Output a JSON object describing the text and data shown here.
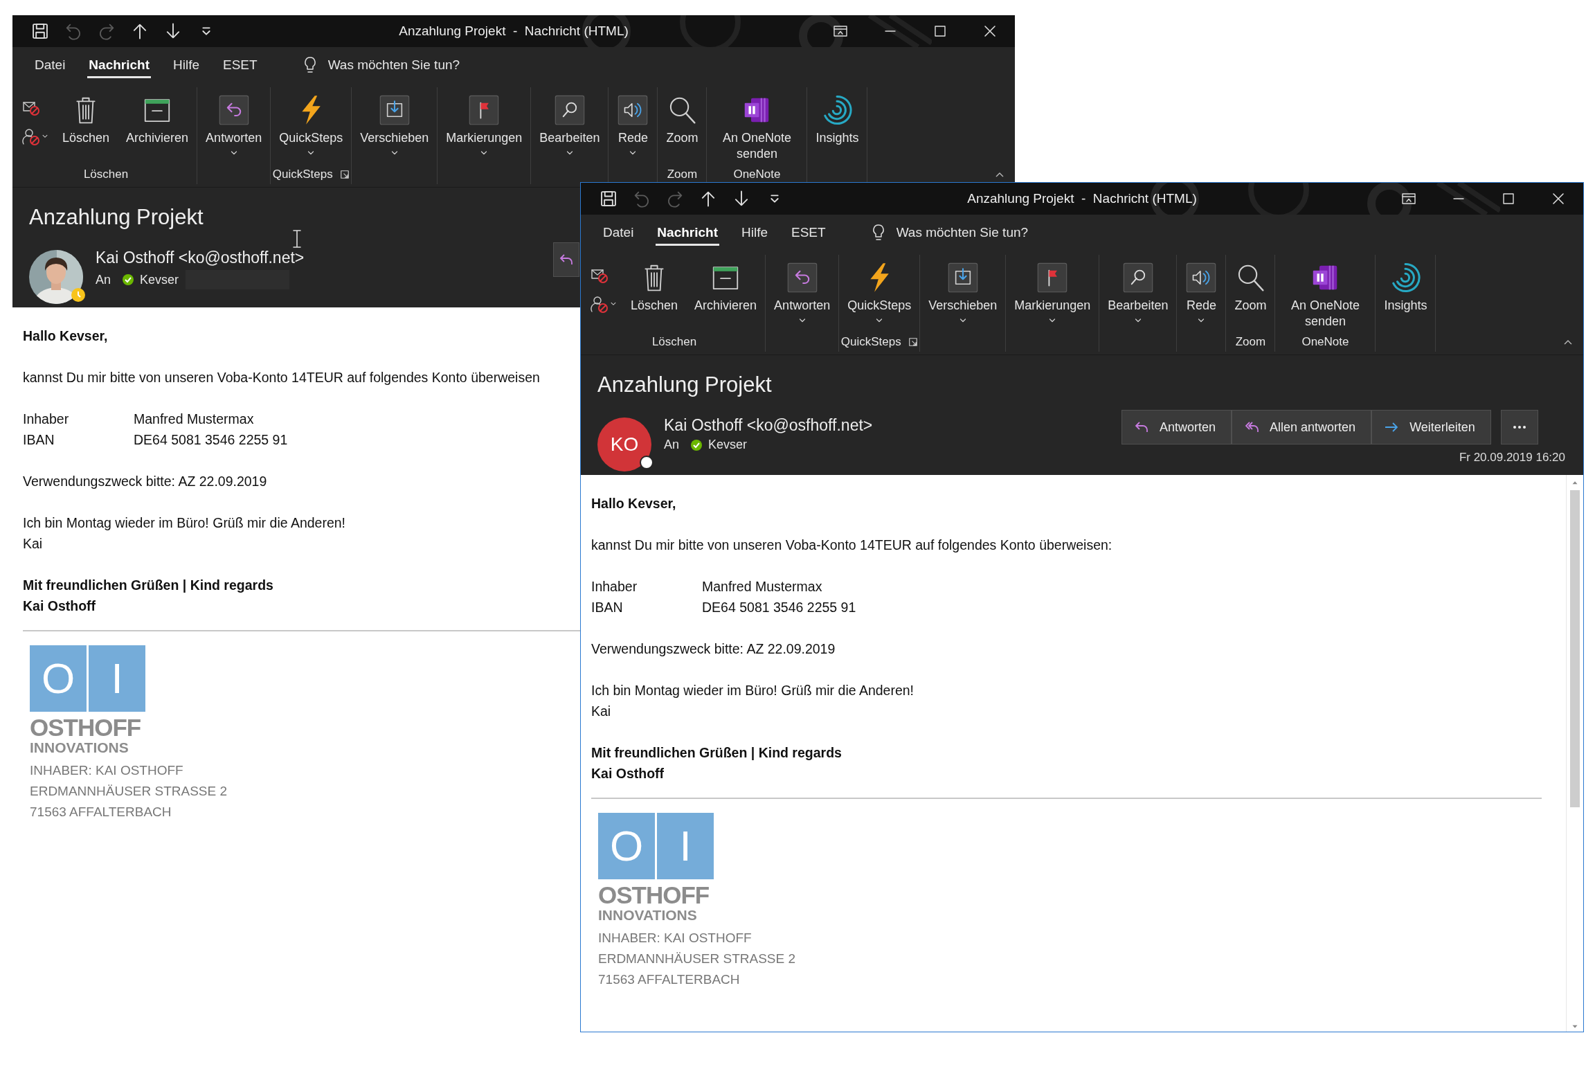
{
  "windows": [
    {
      "title": "Anzahlung Projekt  -  Nachricht (HTML)",
      "quick_access": [
        {
          "kind": "save",
          "disabled": false
        },
        {
          "kind": "undo",
          "disabled": true
        },
        {
          "kind": "redo",
          "disabled": true
        },
        {
          "kind": "up",
          "disabled": false
        },
        {
          "kind": "down",
          "disabled": false
        },
        {
          "kind": "customize",
          "disabled": false
        }
      ],
      "menu": [
        {
          "label": "Datei",
          "selected": false
        },
        {
          "label": "Nachricht",
          "selected": true
        },
        {
          "label": "Hilfe",
          "selected": false
        },
        {
          "label": "ESET",
          "selected": false
        }
      ],
      "tell_me": {
        "placeholder": "Was möchten Sie tun?"
      },
      "ribbon": [
        {
          "label": "Löschen",
          "launcher": false,
          "items": [
            {
              "kind": "small_pair"
            },
            {
              "kind": "delete",
              "label": "Löschen",
              "caret": false
            },
            {
              "kind": "archive",
              "label": "Archivieren",
              "caret": false
            }
          ]
        },
        {
          "items": [
            {
              "kind": "reply",
              "label": "Antworten",
              "caret": true
            }
          ],
          "launcher": false
        },
        {
          "label": "QuickSteps",
          "launcher": true,
          "items": [
            {
              "kind": "quicksteps",
              "label": "QuickSteps",
              "caret": true
            }
          ]
        },
        {
          "items": [
            {
              "kind": "move",
              "label": "Verschieben",
              "caret": true
            }
          ],
          "launcher": false
        },
        {
          "items": [
            {
              "kind": "flag",
              "label": "Markierungen",
              "caret": true
            }
          ],
          "launcher": false
        },
        {
          "items": [
            {
              "kind": "edit",
              "label": "Bearbeiten",
              "caret": true
            }
          ],
          "launcher": false
        },
        {
          "items": [
            {
              "kind": "speech",
              "label": "Rede",
              "caret": true
            }
          ],
          "launcher": false
        },
        {
          "label": "Zoom",
          "launcher": false,
          "items": [
            {
              "kind": "zoom",
              "label": "Zoom",
              "caret": false
            }
          ]
        },
        {
          "label": "OneNote",
          "launcher": false,
          "items": [
            {
              "kind": "onenote",
              "label": "An OneNote senden",
              "caret": false
            }
          ]
        },
        {
          "items": [
            {
              "kind": "insights",
              "label": "Insights",
              "caret": false
            }
          ],
          "launcher": false
        }
      ],
      "header": {
        "subject": "Anzahlung Projekt",
        "away": true,
        "sender": "Kai Osthoff <ko@osthoff.net>",
        "to_label": "An",
        "recipient": "Kevser",
        "redacted": true,
        "actions": [
          {
            "kind": "reply"
          }
        ]
      },
      "body": [
        {
          "kind": "paragraph",
          "bold": true,
          "lines": [
            "Hallo Kevser,"
          ]
        },
        {
          "kind": "paragraph",
          "bold": false,
          "lines": [
            "kannst Du mir bitte von unseren Voba-Konto 14TEUR auf folgendes Konto überweisen"
          ]
        },
        {
          "kind": "fields",
          "rows": [
            {
              "label": "Inhaber",
              "value": "Manfred Mustermax"
            },
            {
              "label": "IBAN",
              "value": "DE64 5081 3546 2255 91"
            }
          ]
        },
        {
          "kind": "paragraph",
          "bold": false,
          "lines": [
            "Verwendungszweck bitte: AZ 22.09.2019"
          ]
        },
        {
          "kind": "paragraph",
          "bold": false,
          "lines": [
            "Ich bin Montag wieder im Büro! Grüß mir die Anderen!",
            "Kai"
          ]
        },
        {
          "kind": "signature",
          "lines": [
            "Mit freundlichen Grüßen | Kind regards",
            "Kai Osthoff"
          ]
        },
        {
          "kind": "rule"
        },
        {
          "kind": "logo",
          "tiles": [
            "O",
            "I"
          ],
          "name": "OSTHOFF",
          "tagline": "INNOVATIONS"
        },
        {
          "kind": "address",
          "lines": [
            "INHABER: KAI OSTHOFF",
            "ERDMANNHÄUSER STRASSE 2",
            "71563 AFFALTERBACH"
          ]
        }
      ]
    },
    {
      "title": "Anzahlung Projekt  -  Nachricht (HTML)",
      "quick_access": [
        {
          "kind": "save",
          "disabled": false
        },
        {
          "kind": "undo",
          "disabled": true
        },
        {
          "kind": "redo",
          "disabled": true
        },
        {
          "kind": "up",
          "disabled": false
        },
        {
          "kind": "down",
          "disabled": false
        },
        {
          "kind": "customize",
          "disabled": false
        }
      ],
      "menu": [
        {
          "label": "Datei",
          "selected": false
        },
        {
          "label": "Nachricht",
          "selected": true
        },
        {
          "label": "Hilfe",
          "selected": false
        },
        {
          "label": "ESET",
          "selected": false
        }
      ],
      "tell_me": {
        "placeholder": "Was möchten Sie tun?"
      },
      "ribbon": [
        {
          "label": "Löschen",
          "launcher": false,
          "items": [
            {
              "kind": "small_pair"
            },
            {
              "kind": "delete",
              "label": "Löschen",
              "caret": false
            },
            {
              "kind": "archive",
              "label": "Archivieren",
              "caret": false
            }
          ]
        },
        {
          "items": [
            {
              "kind": "reply",
              "label": "Antworten",
              "caret": true
            }
          ],
          "launcher": false
        },
        {
          "label": "QuickSteps",
          "launcher": true,
          "items": [
            {
              "kind": "quicksteps",
              "label": "QuickSteps",
              "caret": true
            }
          ]
        },
        {
          "items": [
            {
              "kind": "move",
              "label": "Verschieben",
              "caret": true
            }
          ],
          "launcher": false
        },
        {
          "items": [
            {
              "kind": "flag",
              "label": "Markierungen",
              "caret": true
            }
          ],
          "launcher": false
        },
        {
          "items": [
            {
              "kind": "edit",
              "label": "Bearbeiten",
              "caret": true
            }
          ],
          "launcher": false
        },
        {
          "items": [
            {
              "kind": "speech",
              "label": "Rede",
              "caret": true
            }
          ],
          "launcher": false
        },
        {
          "label": "Zoom",
          "launcher": false,
          "items": [
            {
              "kind": "zoom",
              "label": "Zoom",
              "caret": false
            }
          ]
        },
        {
          "label": "OneNote",
          "launcher": false,
          "items": [
            {
              "kind": "onenote",
              "label": "An OneNote senden",
              "caret": false
            }
          ]
        },
        {
          "items": [
            {
              "kind": "insights",
              "label": "Insights",
              "caret": false
            }
          ],
          "launcher": false
        }
      ],
      "header": {
        "subject": "Anzahlung Projekt",
        "avatar": {
          "kind": "initials",
          "initials": "KO"
        },
        "away": false,
        "sender": "Kai Osthoff <ko@osfhoff.net>",
        "to_label": "An",
        "recipient": "Kevser",
        "redacted": false,
        "actions": [
          {
            "kind": "reply",
            "label": "Antworten"
          },
          {
            "kind": "reply_all",
            "label": "Allen antworten"
          },
          {
            "kind": "forward",
            "label": "Weiterleiten"
          },
          {
            "kind": "more"
          }
        ],
        "date": "Fr 20.09.2019 16:20"
      },
      "body": [
        {
          "kind": "paragraph",
          "bold": true,
          "lines": [
            "Hallo Kevser,"
          ]
        },
        {
          "kind": "paragraph",
          "bold": false,
          "lines": [
            "kannst Du mir bitte von unseren Voba-Konto 14TEUR auf folgendes Konto überweisen:"
          ]
        },
        {
          "kind": "fields",
          "rows": [
            {
              "label": "Inhaber",
              "value": "Manfred Mustermax"
            },
            {
              "label": "IBAN",
              "value": "DE64 5081 3546 2255 91"
            }
          ]
        },
        {
          "kind": "paragraph",
          "bold": false,
          "lines": [
            "Verwendungszweck bitte: AZ 22.09.2019"
          ]
        },
        {
          "kind": "paragraph",
          "bold": false,
          "lines": [
            "Ich bin Montag wieder im Büro! Grüß mir die Anderen!",
            "Kai"
          ]
        },
        {
          "kind": "signature",
          "lines": [
            "Mit freundlichen Grüßen | Kind regards",
            "Kai Osthoff"
          ]
        },
        {
          "kind": "rule"
        },
        {
          "kind": "logo",
          "tiles": [
            "O",
            "I"
          ],
          "name": "OSTHOFF",
          "tagline": "INNOVATIONS"
        },
        {
          "kind": "address",
          "lines": [
            "INHABER: KAI OSTHOFF",
            "ERDMANNHÄUSER STRASSE 2",
            "71563 AFFALTERBACH"
          ]
        }
      ],
      "scrollbar": true
    }
  ]
}
